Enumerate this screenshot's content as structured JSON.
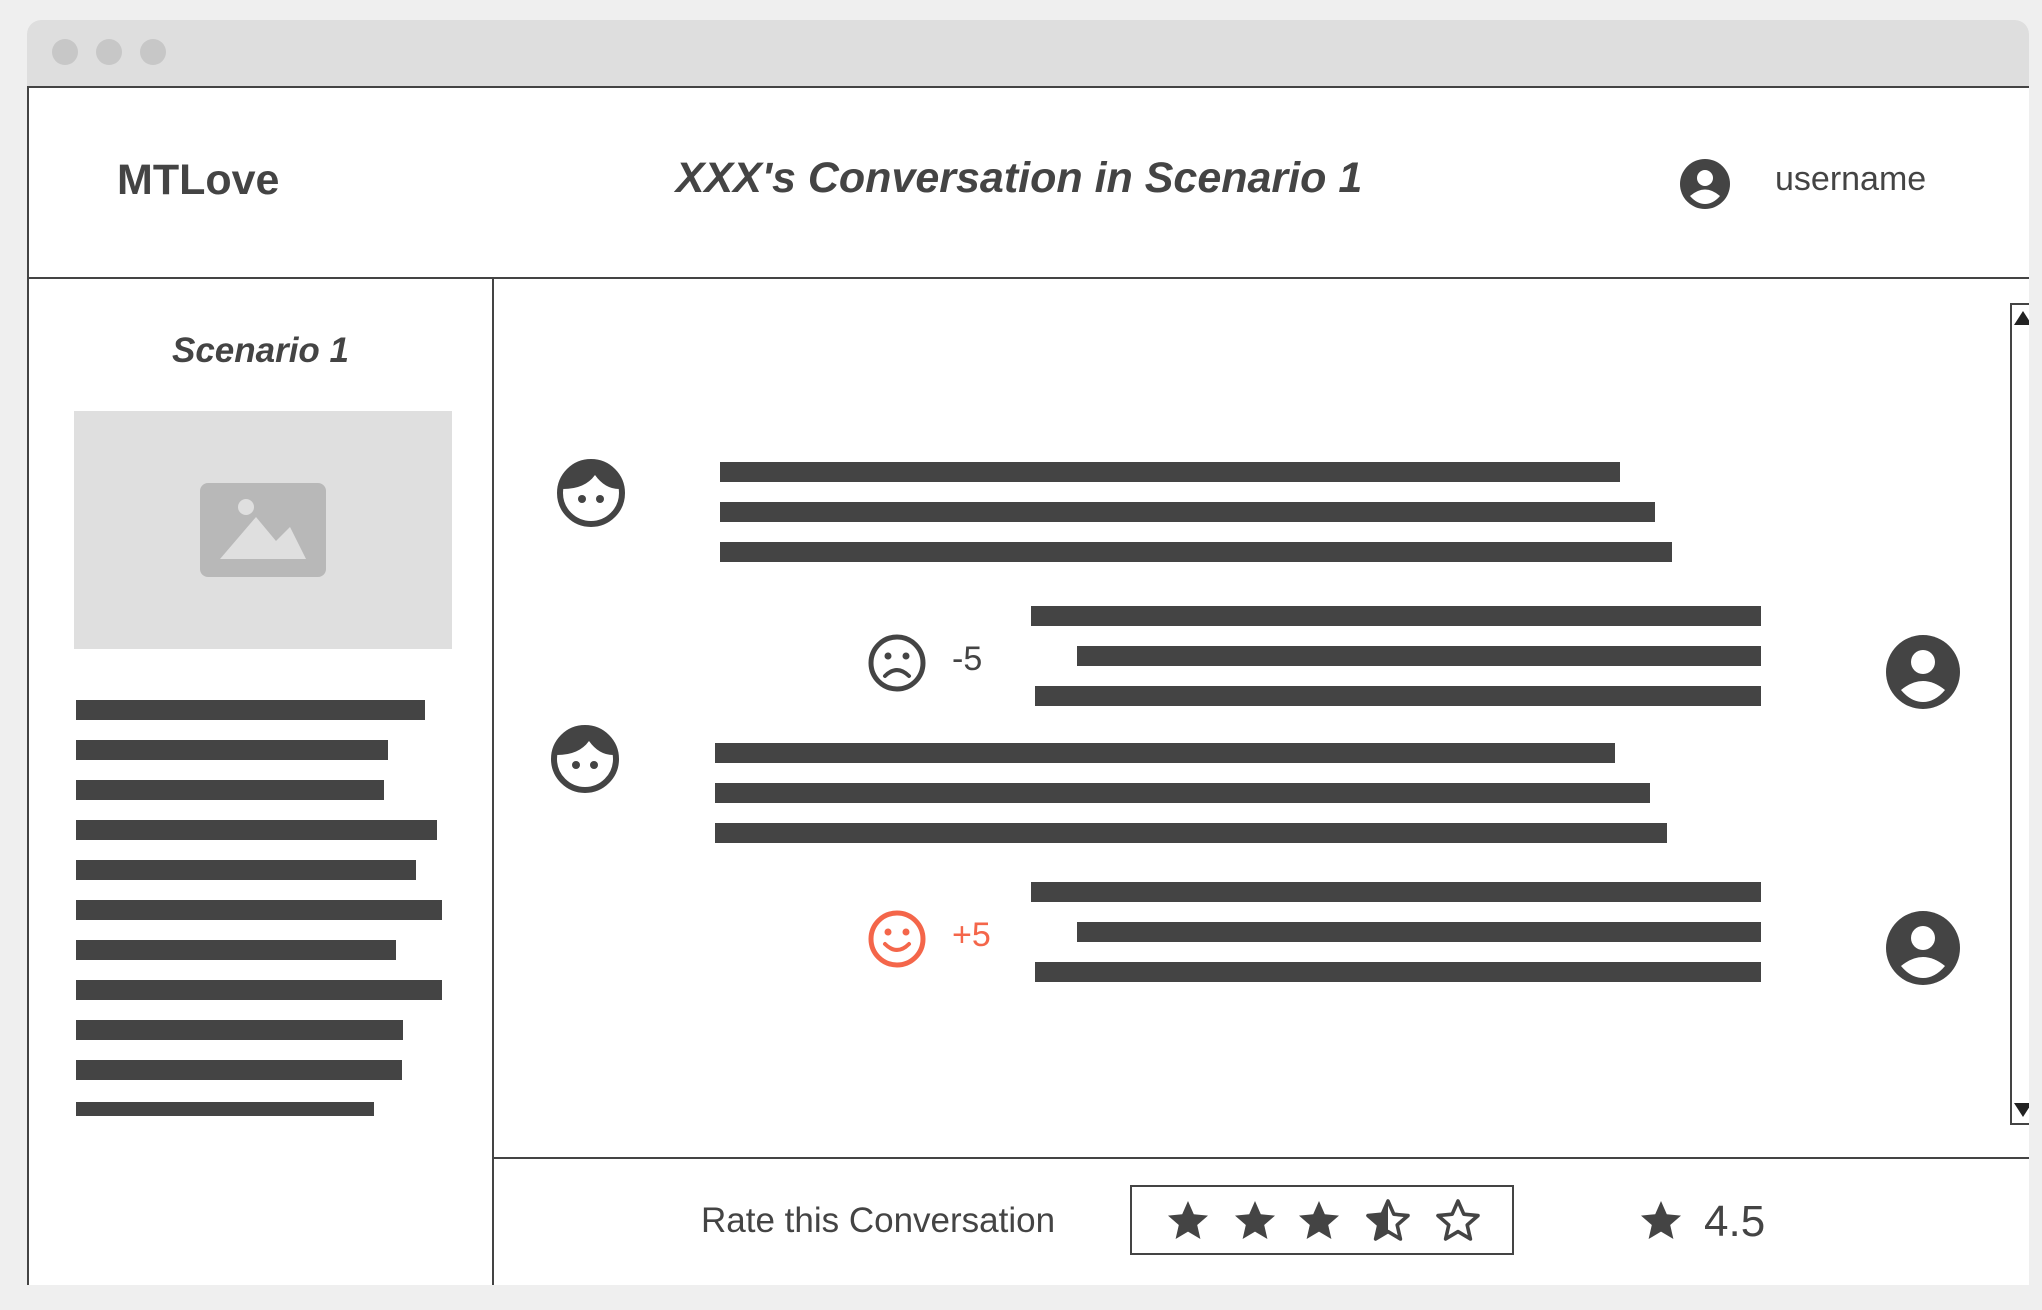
{
  "window": {
    "controls": [
      "close-dot",
      "minimize-dot",
      "maximize-dot"
    ]
  },
  "header": {
    "brand": "MTLove",
    "title": "XXX's Conversation in Scenario 1",
    "username": "username"
  },
  "sidebar": {
    "scenario_title": "Scenario 1",
    "image_icon": "image-placeholder-icon"
  },
  "conversation": {
    "messages": [
      {
        "speaker": "character",
        "icon": "girl-face-icon"
      },
      {
        "speaker": "user",
        "icon": "user-avatar-icon",
        "reaction_icon": "sad-face-icon",
        "score": "-5",
        "score_color": "#444444"
      },
      {
        "speaker": "character",
        "icon": "girl-face-icon"
      },
      {
        "speaker": "user",
        "icon": "user-avatar-icon",
        "reaction_icon": "happy-face-icon",
        "score": "+5",
        "score_color": "#f4664a"
      }
    ]
  },
  "footer": {
    "rate_label": "Rate this Conversation",
    "stars_selected": 3.5,
    "stars_total": 5,
    "rating_value": "4.5"
  },
  "colors": {
    "ink": "#444444",
    "positive": "#f4664a",
    "placeholder": "#dfdfdf"
  }
}
